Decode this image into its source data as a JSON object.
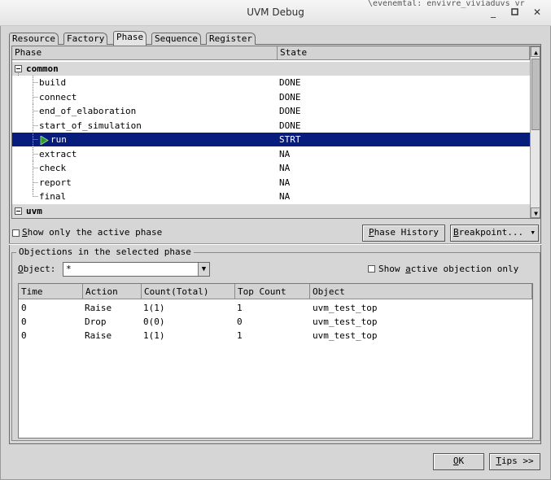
{
  "window": {
    "title": "UVM Debug",
    "background_text": "\\evenemtal: envivre_viviaduvs vr"
  },
  "tabs": [
    {
      "label": "Resource",
      "active": false
    },
    {
      "label": "Factory",
      "active": false
    },
    {
      "label": "Phase",
      "active": true
    },
    {
      "label": "Sequence",
      "active": false
    },
    {
      "label": "Register",
      "active": false
    }
  ],
  "phase_tree": {
    "columns": [
      "Phase",
      "State"
    ],
    "groups": [
      {
        "name": "common",
        "expanded": true,
        "phases": [
          {
            "name": "build",
            "state": "DONE"
          },
          {
            "name": "connect",
            "state": "DONE"
          },
          {
            "name": "end_of_elaboration",
            "state": "DONE"
          },
          {
            "name": "start_of_simulation",
            "state": "DONE"
          },
          {
            "name": "run",
            "state": "STRT",
            "selected": true
          },
          {
            "name": "extract",
            "state": "NA"
          },
          {
            "name": "check",
            "state": "NA"
          },
          {
            "name": "report",
            "state": "NA"
          },
          {
            "name": "final",
            "state": "NA"
          }
        ]
      },
      {
        "name": "uvm",
        "expanded": true
      }
    ]
  },
  "controls": {
    "show_active_phase_prefix": "S",
    "show_active_phase_rest": "how only the active phase",
    "phase_history_first": "P",
    "phase_history_rest": "hase History",
    "breakpoint_first": "B",
    "breakpoint_rest": "reakpoint...",
    "breakpoint_arrow": "▾"
  },
  "objections": {
    "legend": "Objections in the selected phase",
    "object_label_first": "O",
    "object_label_rest": "bject:",
    "object_value": "*",
    "show_active_before": "Show ",
    "show_active_ul": "a",
    "show_active_after": "ctive objection only",
    "columns": [
      "Time",
      "Action",
      "Count(Total)",
      "Top Count",
      "Object"
    ],
    "rows": [
      {
        "time": "0",
        "action": "Raise",
        "count": "1(1)",
        "top": "1",
        "object": "uvm_test_top"
      },
      {
        "time": "0",
        "action": "Drop",
        "count": "0(0)",
        "top": "0",
        "object": "uvm_test_top"
      },
      {
        "time": "0",
        "action": "Raise",
        "count": "1(1)",
        "top": "1",
        "object": "uvm_test_top"
      }
    ]
  },
  "footer": {
    "ok_first": "O",
    "ok_rest": "K",
    "tips_first": "T",
    "tips_rest": "ips >>"
  },
  "colors": {
    "selection": "#071c7d",
    "run_icon": "#2e9b2e"
  }
}
